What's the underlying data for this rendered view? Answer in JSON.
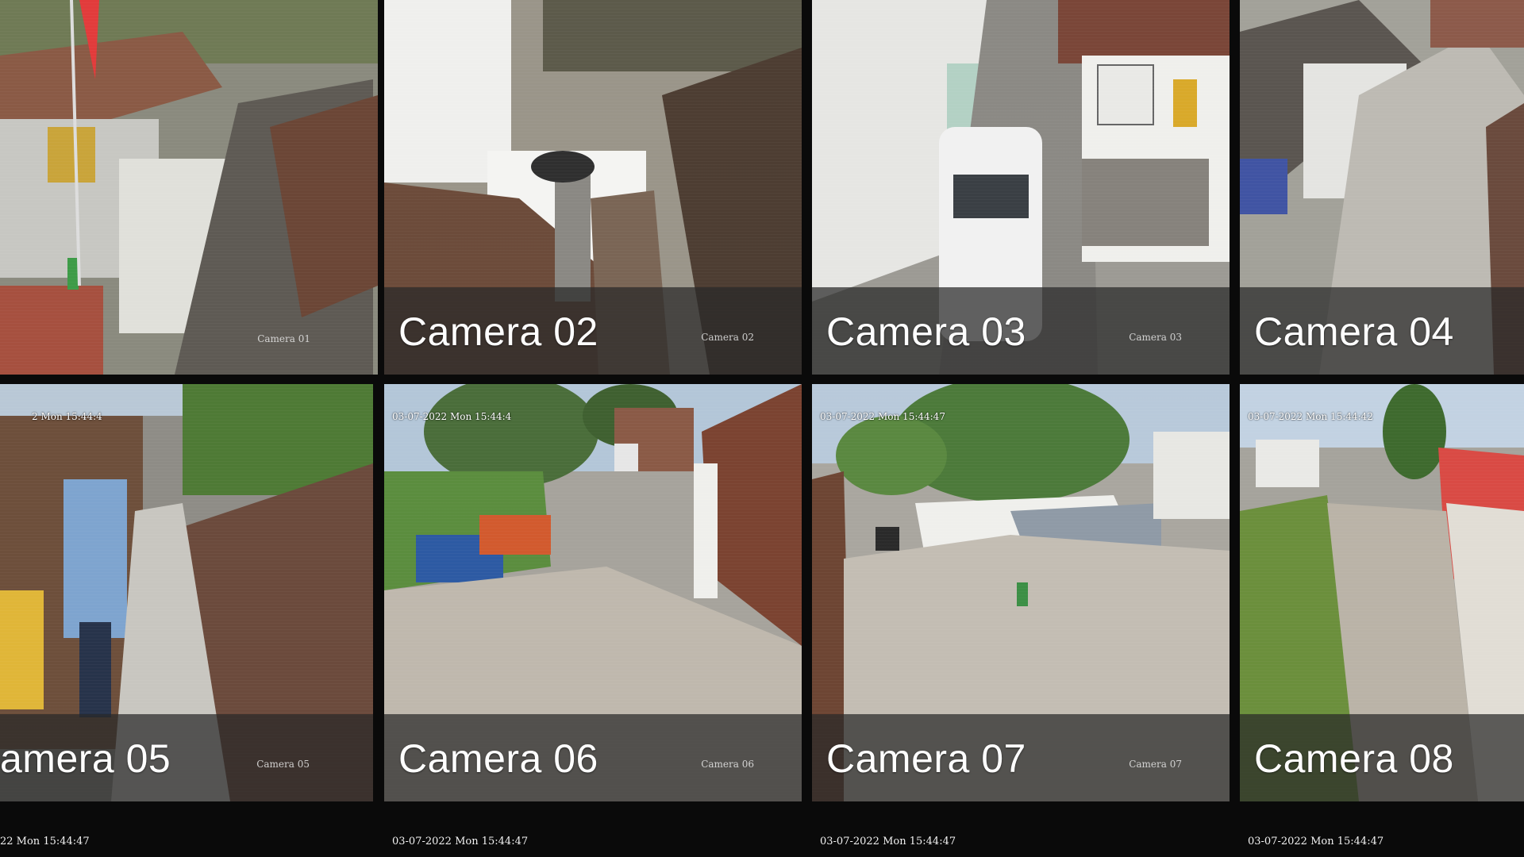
{
  "cameras": [
    {
      "label": "Camera 01",
      "osd_name": "Camera 01",
      "osd_time": "",
      "selected": true
    },
    {
      "label": "Camera 02",
      "osd_name": "Camera 02",
      "osd_time": "",
      "selected": false
    },
    {
      "label": "Camera 03",
      "osd_name": "Camera 03",
      "osd_time": "",
      "selected": false
    },
    {
      "label": "Camera 04",
      "osd_name": "",
      "osd_time": "",
      "selected": false
    },
    {
      "label": "amera 05",
      "osd_name": "Camera 05",
      "osd_time": "2 Mon 15:44:4",
      "selected": false
    },
    {
      "label": "Camera 06",
      "osd_name": "Camera 06",
      "osd_time": "03-07-2022 Mon 15:44:4",
      "selected": false
    },
    {
      "label": "Camera 07",
      "osd_name": "Camera 07",
      "osd_time": "03-07-2022 Mon 15:44:47",
      "selected": false
    },
    {
      "label": "Camera 08",
      "osd_name": "",
      "osd_time": "03-07-2022 Mon 15:44:42",
      "selected": false
    }
  ],
  "footer_timestamps": [
    "22 Mon 15:44:47",
    "03-07-2022 Mon 15:44:47",
    "03-07-2022 Mon 15:44:47",
    "03-07-2022 Mon 15:44:47"
  ],
  "colors": {
    "selection_border": "#1e88e5",
    "label_overlay": "#282828",
    "label_text": "#ffffff"
  }
}
